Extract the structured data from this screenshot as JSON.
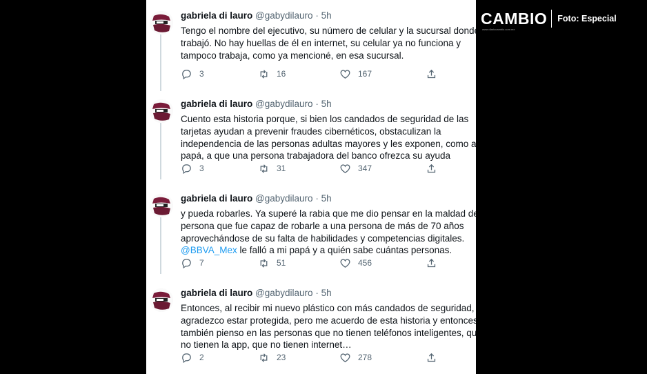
{
  "brand": {
    "logo_text": "CAMBIO",
    "logo_subtext": "www.diariocambio.com.mx",
    "photo_credit": "Foto: Especial"
  },
  "tweets": [
    {
      "name": "gabriela di lauro",
      "handle": "@gabydilauro",
      "separator": "·",
      "time": "5h",
      "lines": [
        "Tengo el nombre del ejecutivo, su número de celular y la sucursal donde",
        "trabajó.  No hay huellas de él en internet, su celular ya no funciona y",
        "tampoco trabaja, como ya mencioné, en esa sucursal."
      ],
      "replies": "3",
      "retweets": "16",
      "likes": "167"
    },
    {
      "name": "gabriela di lauro",
      "handle": "@gabydilauro",
      "separator": "·",
      "time": "5h",
      "lines": [
        "Cuento esta historia porque, si bien los candados de seguridad de las",
        "tarjetas ayudan a prevenir fraudes cibernéticos, obstaculizan la",
        "independencia de las personas adultas mayores y les exponen, como a m",
        "papá, a que una persona trabajadora del banco ofrezca su ayuda"
      ],
      "replies": "3",
      "retweets": "31",
      "likes": "347"
    },
    {
      "name": "gabriela di lauro",
      "handle": "@gabydilauro",
      "separator": "·",
      "time": "5h",
      "lines": [
        "y pueda robarles.  Ya superé la rabia que me dio pensar en la maldad de u",
        "persona que fue capaz de robarle a una persona de más de 70 años",
        "aprovechándose de su falta de habilidades y competencias digitales."
      ],
      "mention": "@BBVA_Mex",
      "mention_rest": " le falló a mi papá y a quién sabe cuántas personas.",
      "replies": "7",
      "retweets": "51",
      "likes": "456"
    },
    {
      "name": "gabriela di lauro",
      "handle": "@gabydilauro",
      "separator": "·",
      "time": "5h",
      "lines": [
        "Entonces, al recibir mi nuevo plástico con más candados de seguridad,",
        "agradezco estar protegida, pero me acuerdo de esta historia y entonces",
        "también pienso en las personas que no tienen teléfonos inteligentes, que",
        "no tienen la app, que no tienen internet…"
      ],
      "replies": "2",
      "retweets": "23",
      "likes": "278"
    }
  ],
  "colors": {
    "text": "#0f1419",
    "muted": "#536471",
    "link": "#1d9bf0",
    "thread_line": "#cfd9de"
  },
  "icons": [
    "reply-icon",
    "retweet-icon",
    "like-icon",
    "share-icon"
  ]
}
